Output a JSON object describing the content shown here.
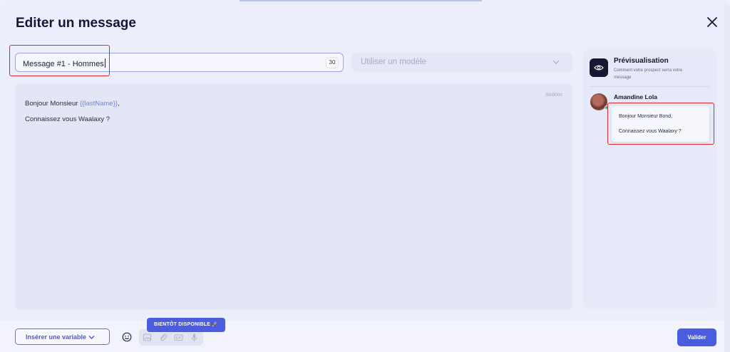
{
  "modal": {
    "title": "Editer un message"
  },
  "name_field": {
    "value": "Message #1 - Hommes",
    "char_count": "30"
  },
  "template_select": {
    "placeholder": "Utiliser un modèle"
  },
  "editor": {
    "counter": "58/8000",
    "line1_prefix": "Bonjour Monsieur ",
    "line1_variable": "{{lastName}}",
    "line1_suffix": ",",
    "line2": "Connaissez vous Waalaxy ?"
  },
  "preview": {
    "title": "Prévisualisation",
    "subtitle": "Comment votre prospect verra votre message",
    "prospect_name": "Amandine Lola",
    "bubble_line1": "Bonjour Monsieur Bond,",
    "bubble_line2": "Connaissez vous Waalaxy ?"
  },
  "footer": {
    "insert_variable_label": "Insérer une variable",
    "coming_soon_badge": "BIENTÔT DISPONIBLE 🚀",
    "validate_label": "Valider"
  },
  "colors": {
    "accent": "#4a5ce0",
    "highlight": "#e0262b",
    "variable": "#6e82e0"
  },
  "icons": [
    "close-icon",
    "chevron-down-icon",
    "eye-icon",
    "emoji-icon",
    "image-icon",
    "paperclip-icon",
    "gif-icon",
    "microphone-icon"
  ]
}
